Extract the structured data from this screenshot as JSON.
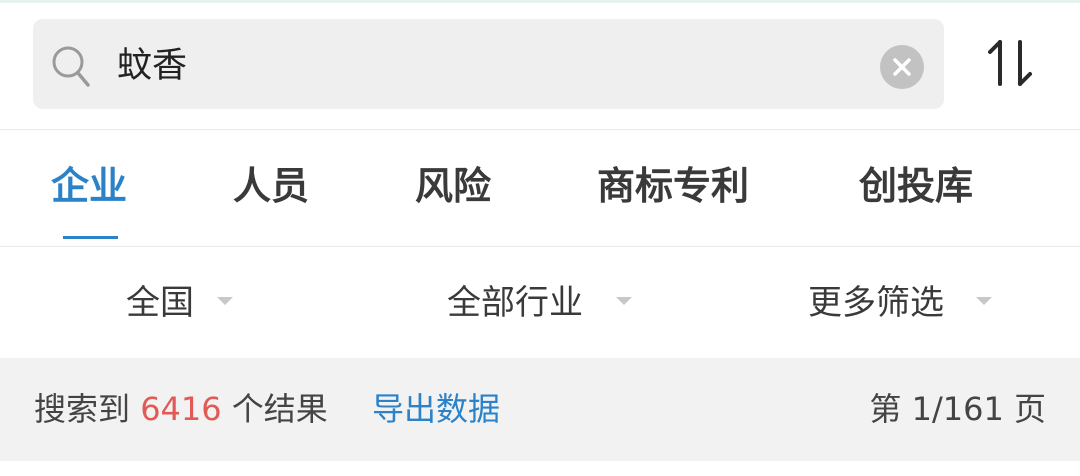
{
  "search": {
    "query": "蚊香",
    "icons": {
      "search": "search-icon",
      "clear": "clear-icon",
      "sort": "sort-icon"
    }
  },
  "tabs": [
    {
      "label": "企业",
      "active": true
    },
    {
      "label": "人员",
      "active": false
    },
    {
      "label": "风险",
      "active": false
    },
    {
      "label": "商标专利",
      "active": false
    },
    {
      "label": "创投库",
      "active": false
    }
  ],
  "filters": [
    {
      "label": "全国"
    },
    {
      "label": "全部行业"
    },
    {
      "label": "更多筛选"
    }
  ],
  "results": {
    "prefix": "搜索到",
    "count": "6416",
    "suffix": "个结果",
    "export_label": "导出数据",
    "page_label": "第 1/161 页"
  },
  "colors": {
    "accent": "#2b82c9",
    "count": "#e15a56",
    "search_bg": "#efefef",
    "result_bg": "#f2f2f2"
  }
}
